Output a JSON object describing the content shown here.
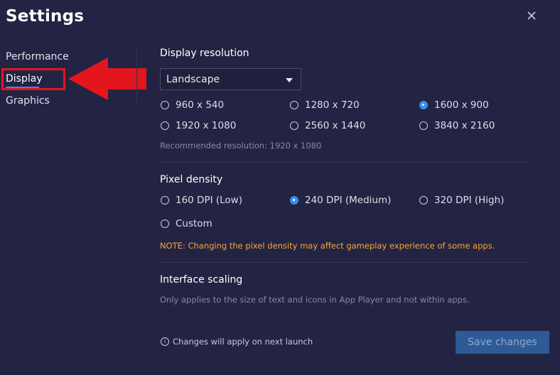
{
  "header": {
    "title": "Settings"
  },
  "sidebar": {
    "items": [
      {
        "label": "Performance"
      },
      {
        "label": "Display"
      },
      {
        "label": "Graphics"
      }
    ]
  },
  "display_resolution": {
    "title": "Display resolution",
    "orientation": "Landscape",
    "options": [
      "960 x 540",
      "1280 x 720",
      "1600 x 900",
      "1920 x 1080",
      "2560 x 1440",
      "3840 x 2160"
    ],
    "selected": "1600 x 900",
    "recommended": "Recommended resolution: 1920 x 1080"
  },
  "pixel_density": {
    "title": "Pixel density",
    "options": [
      "160 DPI (Low)",
      "240 DPI (Medium)",
      "320 DPI (High)",
      "Custom"
    ],
    "selected": "240 DPI (Medium)",
    "note": "NOTE: Changing the pixel density may affect gameplay experience of some apps."
  },
  "interface_scaling": {
    "title": "Interface scaling",
    "description": "Only applies to the size of text and icons in App Player and not within apps."
  },
  "footer": {
    "info": "Changes will apply on next launch",
    "info_icon": "i",
    "save_label": "Save changes"
  },
  "colors": {
    "background": "#232443",
    "accent": "#3a8cf0",
    "highlight": "#e3151d",
    "note": "#f4a63a",
    "button": "#2e5a96"
  },
  "icons": [
    "close-icon",
    "chevron-down-icon",
    "info-icon",
    "red-arrow-annotation"
  ]
}
